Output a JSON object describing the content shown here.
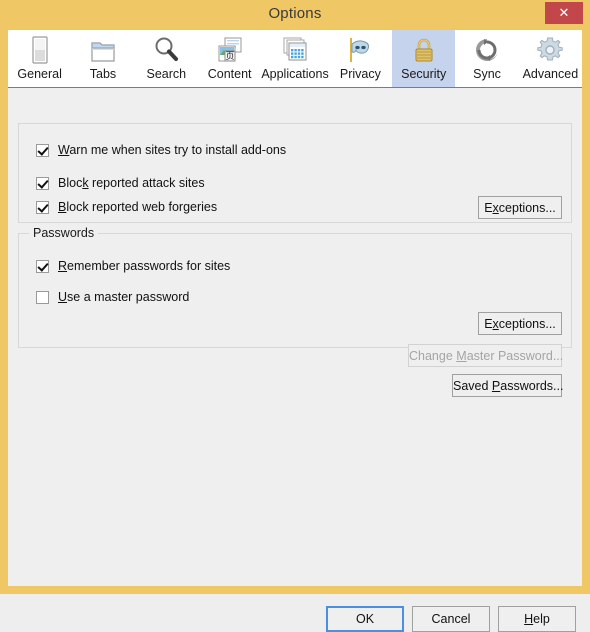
{
  "window": {
    "title": "Options",
    "close_label": "✕"
  },
  "tabs": [
    {
      "id": "general",
      "label": "General",
      "icon": "general-icon",
      "selected": false
    },
    {
      "id": "tabs",
      "label": "Tabs",
      "icon": "tabs-icon",
      "selected": false
    },
    {
      "id": "search",
      "label": "Search",
      "icon": "search-icon",
      "selected": false
    },
    {
      "id": "content",
      "label": "Content",
      "icon": "content-icon",
      "selected": false
    },
    {
      "id": "applications",
      "label": "Applications",
      "icon": "applications-icon",
      "selected": false
    },
    {
      "id": "privacy",
      "label": "Privacy",
      "icon": "privacy-mask-icon",
      "selected": false
    },
    {
      "id": "security",
      "label": "Security",
      "icon": "padlock-icon",
      "selected": true
    },
    {
      "id": "sync",
      "label": "Sync",
      "icon": "sync-arrows-icon",
      "selected": false
    },
    {
      "id": "advanced",
      "label": "Advanced",
      "icon": "gear-icon",
      "selected": false
    }
  ],
  "security_panel": {
    "warnings_group": {
      "checkboxes": [
        {
          "id": "warn-addons",
          "label_pre": "",
          "accel": "W",
          "label_post": "arn me when sites try to install add-ons",
          "checked": true
        },
        {
          "id": "block-attack",
          "label_pre": "Bloc",
          "accel": "k",
          "label_post": " reported attack sites",
          "checked": true
        },
        {
          "id": "block-forgery",
          "label_pre": "",
          "accel": "B",
          "label_post": "lock reported web forgeries",
          "checked": true
        }
      ],
      "exceptions_button": {
        "pre": "E",
        "accel": "x",
        "post": "ceptions...",
        "full": "Exceptions..."
      }
    },
    "passwords_group": {
      "title": "Passwords",
      "checkboxes": [
        {
          "id": "remember-passwords",
          "label_pre": "",
          "accel": "R",
          "label_post": "emember passwords for sites",
          "checked": true
        },
        {
          "id": "use-master-password",
          "label_pre": "",
          "accel": "U",
          "label_post": "se a master password",
          "checked": false
        }
      ],
      "exceptions_button": {
        "pre": "E",
        "accel": "x",
        "post": "ceptions...",
        "full": "Exceptions..."
      },
      "change_master_button": {
        "pre": "Change ",
        "accel": "M",
        "post": "aster Password...",
        "full": "Change Master Password...",
        "disabled": true
      },
      "saved_passwords_button": {
        "pre": "Saved ",
        "accel": "P",
        "post": "asswords...",
        "full": "Saved Passwords...",
        "disabled": false
      }
    }
  },
  "footer": {
    "ok": {
      "label": "OK",
      "default": true
    },
    "cancel": {
      "label": "Cancel"
    },
    "help": {
      "pre": "",
      "accel": "H",
      "post": "elp",
      "full": "Help"
    }
  },
  "colors": {
    "window_frame": "#efc765",
    "close_button": "#c2474a",
    "panel_bg": "#efefef",
    "tab_selected_bg": "#c5d3ed",
    "default_button_border": "#4a90e2"
  }
}
